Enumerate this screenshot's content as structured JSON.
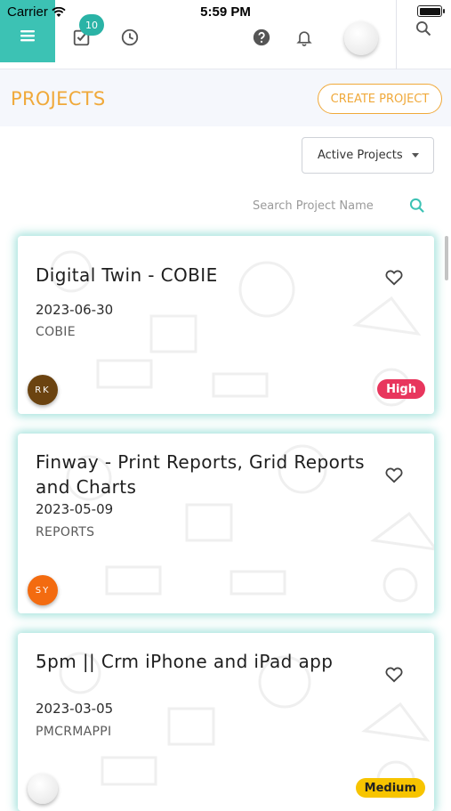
{
  "status_bar": {
    "carrier": "Carrier",
    "time": "5:59 PM"
  },
  "toolbar": {
    "tasks_badge": "10"
  },
  "page": {
    "title": "PROJECTS",
    "create_label": "CREATE PROJECT"
  },
  "filter": {
    "selected": "Active Projects"
  },
  "search": {
    "placeholder": "Search Project Name"
  },
  "colors": {
    "accent": "#3cc2b4",
    "title": "#f0a93a",
    "high": "#e8365d",
    "medium": "#f7c400"
  },
  "projects": [
    {
      "title": "Digital Twin - COBIE",
      "date": "2023-06-30",
      "code": "COBIE",
      "owner_initials": "RK",
      "owner_color": "#6b4310",
      "priority": "High",
      "favorite": false
    },
    {
      "title": "Finway - Print Reports, Grid Reports and Charts",
      "date": "2023-05-09",
      "code": "REPORTS",
      "owner_initials": "SY",
      "owner_color": "#f36b10",
      "priority": "",
      "favorite": false
    },
    {
      "title": "5pm || Crm iPhone and iPad app",
      "date": "2023-03-05",
      "code": "PMCRMAPPI",
      "owner_initials": "",
      "owner_color": "#f2f2f2",
      "priority": "Medium",
      "favorite": false
    }
  ]
}
